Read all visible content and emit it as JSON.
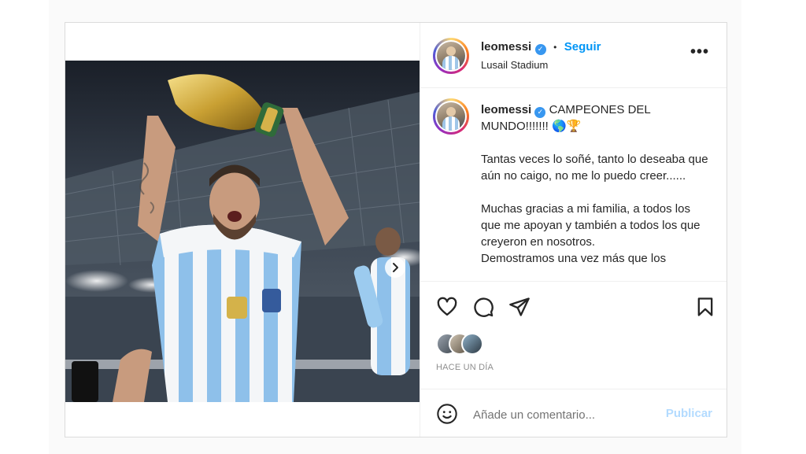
{
  "post": {
    "username": "leomessi",
    "verified_label": "✓",
    "separator": "•",
    "follow_label": "Seguir",
    "location": "Lusail Stadium",
    "more_label": "•••"
  },
  "caption": {
    "username": "leomessi",
    "headline": "CAMPEONES DEL MUNDO!!!!!!! 🌎🏆",
    "paragraph_1": "Tantas veces lo soñé, tanto lo deseaba que aún no caigo, no me lo puedo creer......",
    "paragraph_2": "Muchas gracias a mi familia, a todos los que me apoyan y también a todos los que creyeron en nosotros.",
    "paragraph_3_partial": "Demostramos una vez más que los"
  },
  "meta": {
    "time_label": "HACE UN DÍA"
  },
  "comment": {
    "placeholder": "Añade un comentario...",
    "publish_label": "Publicar"
  },
  "colors": {
    "accent": "#0095f6",
    "publish_disabled": "#b3dbff",
    "verified": "#3897f0",
    "border": "#dbdbdb"
  },
  "icons": {
    "like": "heart-icon",
    "comment": "comment-icon",
    "share": "paper-plane-icon",
    "save": "bookmark-icon",
    "emoji": "smiley-icon",
    "more": "more-options-icon",
    "next": "chevron-right-icon"
  },
  "carousel": {
    "slides": 2,
    "active": 0
  }
}
